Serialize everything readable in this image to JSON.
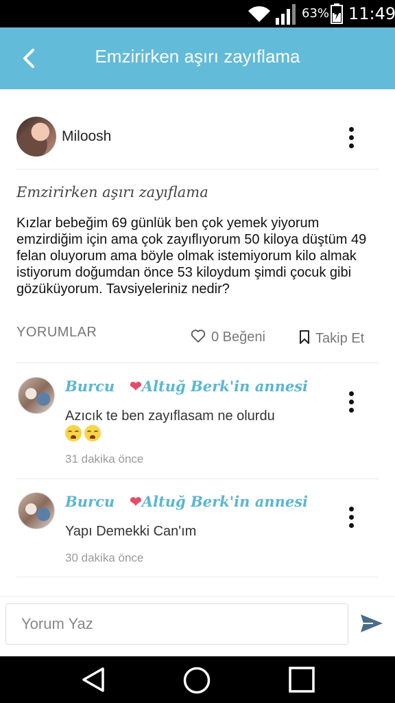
{
  "status_bar": {
    "battery_percent": "63%",
    "time": "11:49"
  },
  "app_bar": {
    "title": "Emzirirken aşırı zayıflama",
    "back_icon": "chevron-left-icon"
  },
  "post": {
    "author": "Miloosh",
    "title": "Emzirirken aşırı zayıflama",
    "body": "Kızlar bebeğim 69 günlük ben çok yemek yiyorum emzirdiğim için ama çok zayıflıyorum 50 kiloya düştüm 49 felan oluyorum ama böyle olmak istemiyorum kilo almak istiyorum doğumdan önce 53 kiloydum şimdi çocuk gibi gözüküyorum. Tavsiyeleriniz nedir?"
  },
  "actions": {
    "comments_label": "YORUMLAR",
    "like_label": "0 Beğeni",
    "follow_label": "Takip Et"
  },
  "comments": [
    {
      "name": "Burcu",
      "heart": "❤",
      "subtitle": "Altuğ Berk'in annesi",
      "text": "Azıcık te ben zayıflasam ne olurdu",
      "time": "31 dakika önce"
    },
    {
      "name": "Burcu",
      "heart": "❤",
      "subtitle": "Altuğ Berk'in annesi",
      "text": "Yapı Demekki Can'ım",
      "time": "30 dakika önce"
    }
  ],
  "input": {
    "placeholder": "Yorum Yaz"
  },
  "colors": {
    "accent": "#62bbd8",
    "name_color": "#5ab6d4",
    "heart": "#e24d6a"
  }
}
